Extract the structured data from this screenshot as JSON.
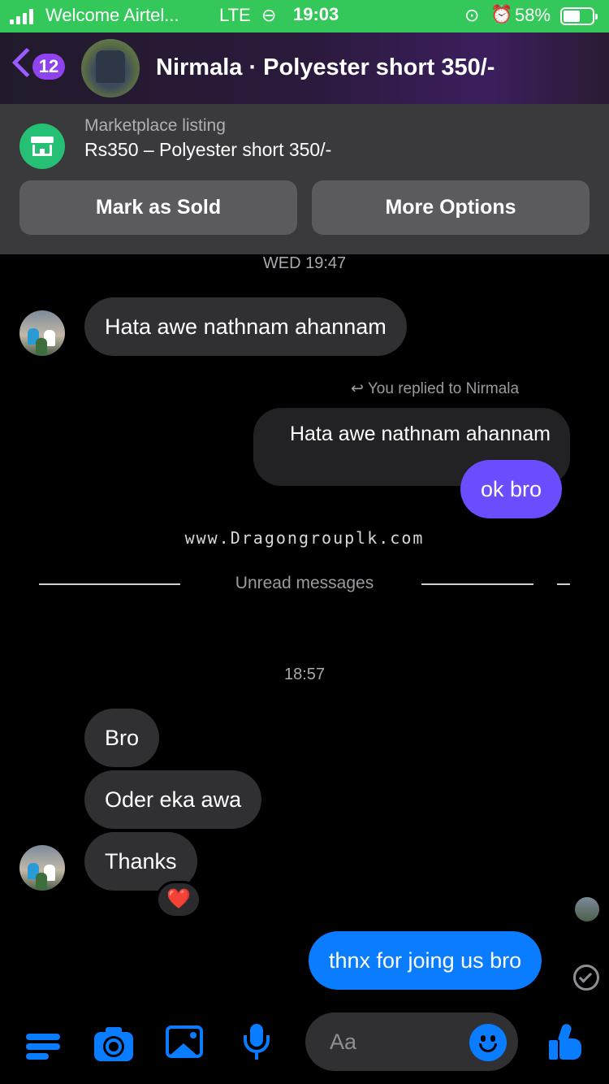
{
  "status": {
    "carrier": "Welcome Airtel...",
    "network": "LTE",
    "link_icon": "link-icon",
    "time": "19:03",
    "battery": "58%",
    "battery_level": 0.58
  },
  "header": {
    "back_count": "12",
    "title": "Nirmala · Polyester short 350/-"
  },
  "listing": {
    "label": "Marketplace listing",
    "text": "Rs350 – Polyester short 350/-",
    "mark_sold": "Mark as Sold",
    "more_options": "More Options"
  },
  "chat": {
    "ts1": "WED 19:47",
    "msg1": "Hata awe nathnam ahannam",
    "replied_label": "You replied to Nirmala",
    "quote": "Hata awe nathnam ahannam",
    "reply": "ok bro",
    "watermark": "www.Dragongrouplk.com",
    "unread": "Unread messages",
    "ts2": "18:57",
    "msg2": "Bro",
    "msg3": "Oder eka awa",
    "msg4": "Thanks",
    "reaction": "❤️",
    "out1": "thnx for joing us bro"
  },
  "composer": {
    "placeholder": "Aa"
  },
  "colors": {
    "status_bar": "#34c759",
    "accent": "#0a7cff",
    "purple_badge": "#8f43ee",
    "marketplace_green": "#25c073"
  }
}
